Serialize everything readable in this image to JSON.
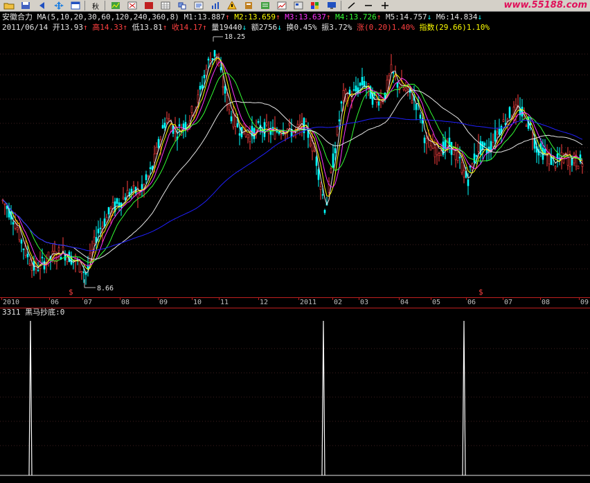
{
  "toolbar": {
    "buttons": [
      "folder-icon",
      "save-icon",
      "prev-icon",
      "move-icon",
      "window-icon",
      "switch-icon",
      "chart-icon",
      "cross-icon",
      "tool-icon",
      "grid-icon",
      "pick-icon",
      "info-icon",
      "warn-icon",
      "book-icon",
      "sheet-icon",
      "stock-icon",
      "table-icon",
      "color-icon",
      "monitor-icon",
      "draw-icon",
      "minus-icon",
      "plus-icon"
    ],
    "period_label": "秋",
    "site": "www.55188.com"
  },
  "header": {
    "stock_name": "安徽合力",
    "ma_params": "MA(5,10,20,30,60,120,240,360,8)",
    "ma_values": [
      {
        "label": "M1:13.887",
        "arrow": "↑",
        "color": "#e6e6e6"
      },
      {
        "label": "M2:13.659",
        "arrow": "↑",
        "color": "#ffff00"
      },
      {
        "label": "M3:13.637",
        "arrow": "↑",
        "color": "#ff33ff"
      },
      {
        "label": "M4:13.726",
        "arrow": "↑",
        "color": "#33ff33"
      },
      {
        "label": "M5:14.757",
        "arrow": "↓",
        "color": "#e6e6e6"
      },
      {
        "label": "M6:14.834",
        "arrow": "↓",
        "color": "#e6e6e6"
      }
    ]
  },
  "quote": {
    "date": "2011/06/14",
    "open": "开13.93",
    "high": "高14.33",
    "low": "低13.81",
    "close": "收14.17",
    "volume": "量19440",
    "amount": "额2756",
    "turnover": "换0.45%",
    "amplitude": "振3.72%",
    "change": "涨(0.20)1.40%",
    "index": "指数(29.66)1.10%"
  },
  "chart_data": {
    "type": "candlestick",
    "annotations": {
      "high": "18.25",
      "low": "8.66"
    },
    "signal_markers": [
      "$",
      "$"
    ],
    "x_labels": [
      "2010",
      "06",
      "07",
      "08",
      "09",
      "10",
      "11",
      "12",
      "2011",
      "02",
      "03",
      "04",
      "05",
      "06",
      "07",
      "08",
      "09"
    ],
    "indicator": {
      "name": "3311 黑马抄底:0",
      "spikes": 3
    },
    "colors": {
      "up": "#ff4040",
      "down": "#00ffff",
      "ma1": "#e6e6e6",
      "ma2": "#ffff00",
      "ma3": "#ff33ff",
      "ma4": "#33ff33",
      "ma5": "#e6e6e6",
      "ma6": "#2020ff"
    }
  }
}
